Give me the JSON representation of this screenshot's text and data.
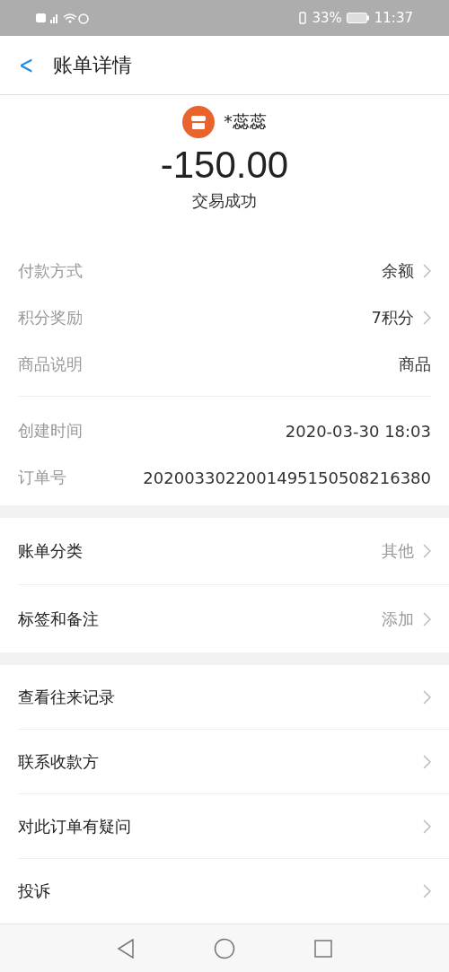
{
  "status_bar": {
    "battery": "33%",
    "time": "11:37"
  },
  "header": {
    "back": "<",
    "title": "账单详情"
  },
  "merchant": {
    "name": "*蕊蕊",
    "amount": "-150.00",
    "status": "交易成功"
  },
  "details": [
    {
      "label": "付款方式",
      "value": "余额",
      "chevron": true
    },
    {
      "label": "积分奖励",
      "value": "7积分",
      "chevron": true
    },
    {
      "label": "商品说明",
      "value": "商品",
      "chevron": false
    }
  ],
  "order_info": [
    {
      "label": "创建时间",
      "value": "2020-03-30 18:03"
    },
    {
      "label": "订单号",
      "value": "2020033022001495150508216380"
    }
  ],
  "category_rows": [
    {
      "label": "账单分类",
      "value": "其他"
    },
    {
      "label": "标签和备注",
      "value": "添加"
    }
  ],
  "action_rows": [
    {
      "label": "查看往来记录"
    },
    {
      "label": "联系收款方"
    },
    {
      "label": "对此订单有疑问"
    },
    {
      "label": "投诉"
    }
  ]
}
